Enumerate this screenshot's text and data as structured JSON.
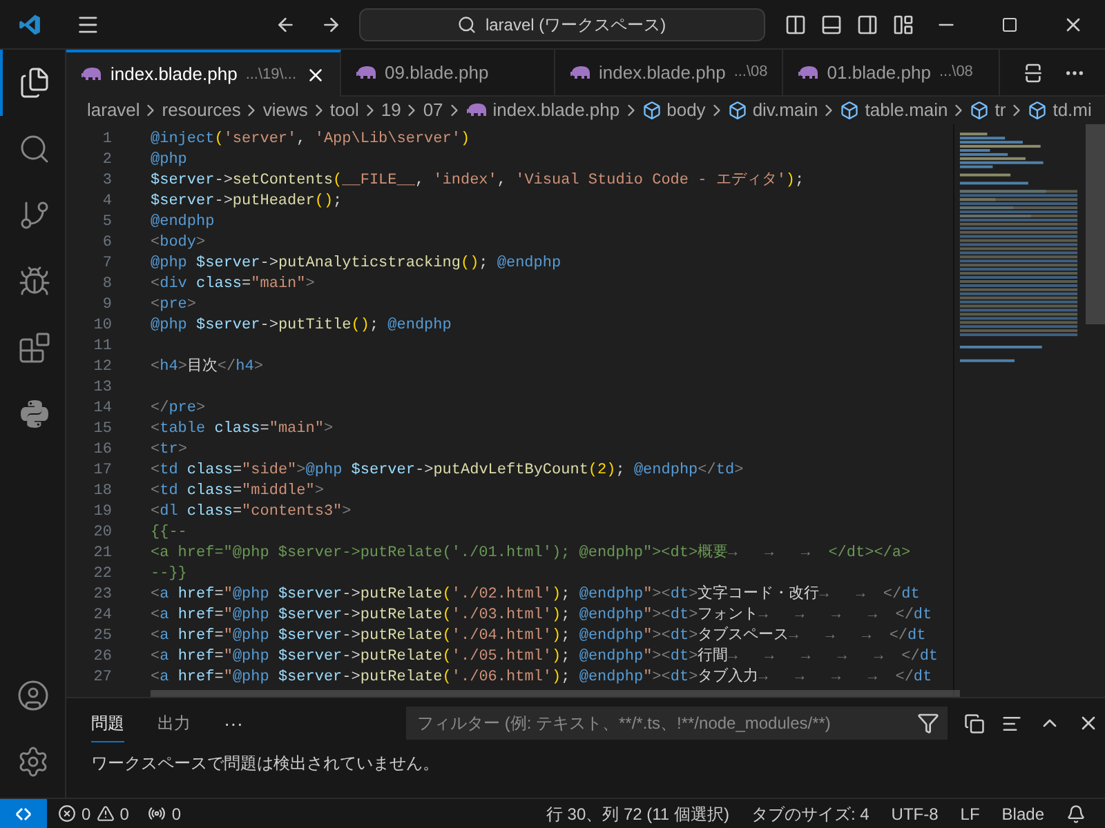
{
  "title_bar": {
    "search": "laravel (ワークスペース)"
  },
  "activity_bar": [
    {
      "kind": "files",
      "selected": true
    },
    {
      "kind": "search",
      "selected": false
    },
    {
      "kind": "source-control",
      "selected": false
    },
    {
      "kind": "run-debug",
      "selected": false
    },
    {
      "kind": "extensions",
      "selected": false
    },
    {
      "kind": "python",
      "selected": false
    }
  ],
  "activity_bar_bottom": [
    {
      "kind": "account"
    },
    {
      "kind": "settings"
    }
  ],
  "tabs": [
    {
      "label": "index.blade.php",
      "path": "...\\19\\...",
      "selected": true,
      "close": true
    },
    {
      "label": "09.blade.php",
      "selected": false,
      "close": false
    },
    {
      "label": "index.blade.php",
      "path": "...\\08",
      "selected": false,
      "close": false
    },
    {
      "label": "01.blade.php",
      "path": "...\\08",
      "selected": false,
      "close": false
    }
  ],
  "breadcrumb": [
    {
      "kind": "folder",
      "text": "laravel"
    },
    {
      "kind": "folder",
      "text": "resources"
    },
    {
      "kind": "folder",
      "text": "views"
    },
    {
      "kind": "folder",
      "text": "tool"
    },
    {
      "kind": "folder",
      "text": "19"
    },
    {
      "kind": "folder",
      "text": "07"
    },
    {
      "kind": "file",
      "text": "index.blade.php"
    },
    {
      "kind": "symbol",
      "text": "body"
    },
    {
      "kind": "symbol",
      "text": "div.main"
    },
    {
      "kind": "symbol",
      "text": "table.main"
    },
    {
      "kind": "symbol",
      "text": "tr"
    },
    {
      "kind": "symbol",
      "text": "td.mi"
    }
  ],
  "editor": {
    "lines": [
      {
        "number": "1",
        "tokens": [
          {
            "kind": "dir",
            "text": "@inject"
          },
          {
            "kind": "paren",
            "text": "("
          },
          {
            "kind": "str",
            "text": "'server'"
          },
          {
            "kind": "plain",
            "text": ", "
          },
          {
            "kind": "str",
            "text": "'App\\Lib\\server'"
          },
          {
            "kind": "paren",
            "text": ")"
          }
        ]
      },
      {
        "number": "2",
        "tokens": [
          {
            "kind": "dir",
            "text": "@php"
          }
        ]
      },
      {
        "number": "3",
        "tokens": [
          {
            "kind": "var",
            "text": "$server"
          },
          {
            "kind": "plain",
            "text": "->"
          },
          {
            "kind": "func",
            "text": "setContents"
          },
          {
            "kind": "paren",
            "text": "("
          },
          {
            "kind": "str",
            "text": "__FILE__"
          },
          {
            "kind": "plain",
            "text": ", "
          },
          {
            "kind": "str",
            "text": "'index'"
          },
          {
            "kind": "plain",
            "text": ", "
          },
          {
            "kind": "str",
            "text": "'Visual Studio Code - エディタ'"
          },
          {
            "kind": "paren",
            "text": ")"
          },
          {
            "kind": "plain",
            "text": ";"
          }
        ]
      },
      {
        "number": "4",
        "tokens": [
          {
            "kind": "var",
            "text": "$server"
          },
          {
            "kind": "plain",
            "text": "->"
          },
          {
            "kind": "func",
            "text": "putHeader"
          },
          {
            "kind": "paren",
            "text": "()"
          },
          {
            "kind": "plain",
            "text": ";"
          }
        ]
      },
      {
        "number": "5",
        "tokens": [
          {
            "kind": "dir",
            "text": "@endphp"
          }
        ]
      },
      {
        "number": "6",
        "tokens": [
          {
            "kind": "br",
            "text": "<"
          },
          {
            "kind": "tag",
            "text": "body"
          },
          {
            "kind": "br",
            "text": ">"
          }
        ]
      },
      {
        "number": "7",
        "tokens": [
          {
            "kind": "dir",
            "text": "@php "
          },
          {
            "kind": "var",
            "text": "$server"
          },
          {
            "kind": "plain",
            "text": "->"
          },
          {
            "kind": "func",
            "text": "putAnalyticstracking"
          },
          {
            "kind": "paren",
            "text": "()"
          },
          {
            "kind": "plain",
            "text": "; "
          },
          {
            "kind": "dir",
            "text": "@endphp"
          }
        ]
      },
      {
        "number": "8",
        "tokens": [
          {
            "kind": "br",
            "text": "<"
          },
          {
            "kind": "tag",
            "text": "div "
          },
          {
            "kind": "attr",
            "text": "class"
          },
          {
            "kind": "plain",
            "text": "="
          },
          {
            "kind": "str",
            "text": "\"main\""
          },
          {
            "kind": "br",
            "text": ">"
          }
        ]
      },
      {
        "number": "9",
        "tokens": [
          {
            "kind": "br",
            "text": "<"
          },
          {
            "kind": "tag",
            "text": "pre"
          },
          {
            "kind": "br",
            "text": ">"
          }
        ]
      },
      {
        "number": "10",
        "tokens": [
          {
            "kind": "dir",
            "text": "@php "
          },
          {
            "kind": "var",
            "text": "$server"
          },
          {
            "kind": "plain",
            "text": "->"
          },
          {
            "kind": "func",
            "text": "putTitle"
          },
          {
            "kind": "paren",
            "text": "()"
          },
          {
            "kind": "plain",
            "text": "; "
          },
          {
            "kind": "dir",
            "text": "@endphp"
          }
        ]
      },
      {
        "number": "11"
      },
      {
        "number": "12",
        "tokens": [
          {
            "kind": "br",
            "text": "<"
          },
          {
            "kind": "tag",
            "text": "h4"
          },
          {
            "kind": "br",
            "text": ">"
          },
          {
            "kind": "plain",
            "text": "目次"
          },
          {
            "kind": "br",
            "text": "</"
          },
          {
            "kind": "tag",
            "text": "h4"
          },
          {
            "kind": "br",
            "text": ">"
          }
        ]
      },
      {
        "number": "13"
      },
      {
        "number": "14",
        "tokens": [
          {
            "kind": "br",
            "text": "</"
          },
          {
            "kind": "tag",
            "text": "pre"
          },
          {
            "kind": "br",
            "text": ">"
          }
        ]
      },
      {
        "number": "15",
        "tokens": [
          {
            "kind": "br",
            "text": "<"
          },
          {
            "kind": "tag",
            "text": "table "
          },
          {
            "kind": "attr",
            "text": "class"
          },
          {
            "kind": "plain",
            "text": "="
          },
          {
            "kind": "str",
            "text": "\"main\""
          },
          {
            "kind": "br",
            "text": ">"
          }
        ]
      },
      {
        "number": "16",
        "tokens": [
          {
            "kind": "br",
            "text": "<"
          },
          {
            "kind": "tag",
            "text": "tr"
          },
          {
            "kind": "br",
            "text": ">"
          }
        ]
      },
      {
        "number": "17",
        "tokens": [
          {
            "kind": "br",
            "text": "<"
          },
          {
            "kind": "tag",
            "text": "td "
          },
          {
            "kind": "attr",
            "text": "class"
          },
          {
            "kind": "plain",
            "text": "="
          },
          {
            "kind": "str",
            "text": "\"side\""
          },
          {
            "kind": "br",
            "text": ">"
          },
          {
            "kind": "dir",
            "text": "@php "
          },
          {
            "kind": "var",
            "text": "$server"
          },
          {
            "kind": "plain",
            "text": "->"
          },
          {
            "kind": "func",
            "text": "putAdvLeftByCount"
          },
          {
            "kind": "paren",
            "text": "(2)"
          },
          {
            "kind": "plain",
            "text": "; "
          },
          {
            "kind": "dir",
            "text": "@endphp"
          },
          {
            "kind": "br",
            "text": "</"
          },
          {
            "kind": "tag",
            "text": "td"
          },
          {
            "kind": "br",
            "text": ">"
          }
        ]
      },
      {
        "number": "18",
        "tokens": [
          {
            "kind": "br",
            "text": "<"
          },
          {
            "kind": "tag",
            "text": "td "
          },
          {
            "kind": "attr",
            "text": "class"
          },
          {
            "kind": "plain",
            "text": "="
          },
          {
            "kind": "str",
            "text": "\"middle\""
          },
          {
            "kind": "br",
            "text": ">"
          }
        ]
      },
      {
        "number": "19",
        "tokens": [
          {
            "kind": "br",
            "text": "<"
          },
          {
            "kind": "tag",
            "text": "dl "
          },
          {
            "kind": "attr",
            "text": "class"
          },
          {
            "kind": "plain",
            "text": "="
          },
          {
            "kind": "str",
            "text": "\"contents3\""
          },
          {
            "kind": "br",
            "text": ">"
          }
        ]
      },
      {
        "number": "20",
        "tokens": [
          {
            "kind": "comment",
            "text": "{{--"
          }
        ]
      },
      {
        "number": "21",
        "tokens": [
          {
            "kind": "comment",
            "text": "<a href=\"@php $server->putRelate('./01.html'); @endphp\"><dt>概要"
          },
          {
            "kind": "ws",
            "text": "→   →   →  "
          },
          {
            "kind": "comment",
            "text": "</dt></a>"
          }
        ]
      },
      {
        "number": "22",
        "tokens": [
          {
            "kind": "comment",
            "text": "--}}"
          }
        ]
      },
      {
        "number": "23",
        "tokens": [
          {
            "kind": "br",
            "text": "<"
          },
          {
            "kind": "tag",
            "text": "a "
          },
          {
            "kind": "attr",
            "text": "href"
          },
          {
            "kind": "plain",
            "text": "="
          },
          {
            "kind": "str",
            "text": "\""
          },
          {
            "kind": "dir",
            "text": "@php "
          },
          {
            "kind": "var",
            "text": "$server"
          },
          {
            "kind": "plain",
            "text": "->"
          },
          {
            "kind": "func",
            "text": "putRelate"
          },
          {
            "kind": "paren",
            "text": "("
          },
          {
            "kind": "str",
            "text": "'./02.html'"
          },
          {
            "kind": "paren",
            "text": ")"
          },
          {
            "kind": "plain",
            "text": "; "
          },
          {
            "kind": "dir",
            "text": "@endphp"
          },
          {
            "kind": "str",
            "text": "\""
          },
          {
            "kind": "br",
            "text": "><"
          },
          {
            "kind": "tag",
            "text": "dt"
          },
          {
            "kind": "br",
            "text": ">"
          },
          {
            "kind": "plain",
            "text": "文字コード・改行"
          },
          {
            "kind": "ws",
            "text": "→   →  "
          },
          {
            "kind": "br",
            "text": "</"
          },
          {
            "kind": "tag",
            "text": "dt"
          }
        ]
      },
      {
        "number": "24",
        "tokens": [
          {
            "kind": "br",
            "text": "<"
          },
          {
            "kind": "tag",
            "text": "a "
          },
          {
            "kind": "attr",
            "text": "href"
          },
          {
            "kind": "plain",
            "text": "="
          },
          {
            "kind": "str",
            "text": "\""
          },
          {
            "kind": "dir",
            "text": "@php "
          },
          {
            "kind": "var",
            "text": "$server"
          },
          {
            "kind": "plain",
            "text": "->"
          },
          {
            "kind": "func",
            "text": "putRelate"
          },
          {
            "kind": "paren",
            "text": "("
          },
          {
            "kind": "str",
            "text": "'./03.html'"
          },
          {
            "kind": "paren",
            "text": ")"
          },
          {
            "kind": "plain",
            "text": "; "
          },
          {
            "kind": "dir",
            "text": "@endphp"
          },
          {
            "kind": "str",
            "text": "\""
          },
          {
            "kind": "br",
            "text": "><"
          },
          {
            "kind": "tag",
            "text": "dt"
          },
          {
            "kind": "br",
            "text": ">"
          },
          {
            "kind": "plain",
            "text": "フォント"
          },
          {
            "kind": "ws",
            "text": "→   →   →   →  "
          },
          {
            "kind": "br",
            "text": "</"
          },
          {
            "kind": "tag",
            "text": "dt"
          }
        ]
      },
      {
        "number": "25",
        "tokens": [
          {
            "kind": "br",
            "text": "<"
          },
          {
            "kind": "tag",
            "text": "a "
          },
          {
            "kind": "attr",
            "text": "href"
          },
          {
            "kind": "plain",
            "text": "="
          },
          {
            "kind": "str",
            "text": "\""
          },
          {
            "kind": "dir",
            "text": "@php "
          },
          {
            "kind": "var",
            "text": "$server"
          },
          {
            "kind": "plain",
            "text": "->"
          },
          {
            "kind": "func",
            "text": "putRelate"
          },
          {
            "kind": "paren",
            "text": "("
          },
          {
            "kind": "str",
            "text": "'./04.html'"
          },
          {
            "kind": "paren",
            "text": ")"
          },
          {
            "kind": "plain",
            "text": "; "
          },
          {
            "kind": "dir",
            "text": "@endphp"
          },
          {
            "kind": "str",
            "text": "\""
          },
          {
            "kind": "br",
            "text": "><"
          },
          {
            "kind": "tag",
            "text": "dt"
          },
          {
            "kind": "br",
            "text": ">"
          },
          {
            "kind": "plain",
            "text": "タブスペース"
          },
          {
            "kind": "ws",
            "text": "→   →   →  "
          },
          {
            "kind": "br",
            "text": "</"
          },
          {
            "kind": "tag",
            "text": "dt"
          }
        ]
      },
      {
        "number": "26",
        "tokens": [
          {
            "kind": "br",
            "text": "<"
          },
          {
            "kind": "tag",
            "text": "a "
          },
          {
            "kind": "attr",
            "text": "href"
          },
          {
            "kind": "plain",
            "text": "="
          },
          {
            "kind": "str",
            "text": "\""
          },
          {
            "kind": "dir",
            "text": "@php "
          },
          {
            "kind": "var",
            "text": "$server"
          },
          {
            "kind": "plain",
            "text": "->"
          },
          {
            "kind": "func",
            "text": "putRelate"
          },
          {
            "kind": "paren",
            "text": "("
          },
          {
            "kind": "str",
            "text": "'./05.html'"
          },
          {
            "kind": "paren",
            "text": ")"
          },
          {
            "kind": "plain",
            "text": "; "
          },
          {
            "kind": "dir",
            "text": "@endphp"
          },
          {
            "kind": "str",
            "text": "\""
          },
          {
            "kind": "br",
            "text": "><"
          },
          {
            "kind": "tag",
            "text": "dt"
          },
          {
            "kind": "br",
            "text": ">"
          },
          {
            "kind": "plain",
            "text": "行間"
          },
          {
            "kind": "ws",
            "text": "→   →   →   →   →  "
          },
          {
            "kind": "br",
            "text": "</"
          },
          {
            "kind": "tag",
            "text": "dt"
          }
        ]
      },
      {
        "number": "27",
        "tokens": [
          {
            "kind": "br",
            "text": "<"
          },
          {
            "kind": "tag",
            "text": "a "
          },
          {
            "kind": "attr",
            "text": "href"
          },
          {
            "kind": "plain",
            "text": "="
          },
          {
            "kind": "str",
            "text": "\""
          },
          {
            "kind": "dir",
            "text": "@php "
          },
          {
            "kind": "var",
            "text": "$server"
          },
          {
            "kind": "plain",
            "text": "->"
          },
          {
            "kind": "func",
            "text": "putRelate"
          },
          {
            "kind": "paren",
            "text": "("
          },
          {
            "kind": "str",
            "text": "'./06.html'"
          },
          {
            "kind": "paren",
            "text": ")"
          },
          {
            "kind": "plain",
            "text": "; "
          },
          {
            "kind": "dir",
            "text": "@endphp"
          },
          {
            "kind": "str",
            "text": "\""
          },
          {
            "kind": "br",
            "text": "><"
          },
          {
            "kind": "tag",
            "text": "dt"
          },
          {
            "kind": "br",
            "text": ">"
          },
          {
            "kind": "plain",
            "text": "タブ入力"
          },
          {
            "kind": "ws",
            "text": "→   →   →   →  "
          },
          {
            "kind": "br",
            "text": "</"
          },
          {
            "kind": "tag",
            "text": "dt"
          }
        ]
      }
    ]
  },
  "panel": {
    "tabs": [
      {
        "label": "問題",
        "selected": true
      },
      {
        "label": "出力",
        "selected": false
      }
    ],
    "more": "···",
    "filter": {
      "placeholder": "フィルター (例: テキスト、**/*.ts、!**/node_modules/**)"
    },
    "message": "ワークスペースで問題は検出されていません。"
  },
  "status_bar": {
    "errors": "0",
    "warnings": "0",
    "ports": "0",
    "position": "行 30、列 72 (11 個選択)",
    "tab_size": "タブのサイズ: 4",
    "encoding": "UTF-8",
    "eol": "LF",
    "language": "Blade"
  }
}
